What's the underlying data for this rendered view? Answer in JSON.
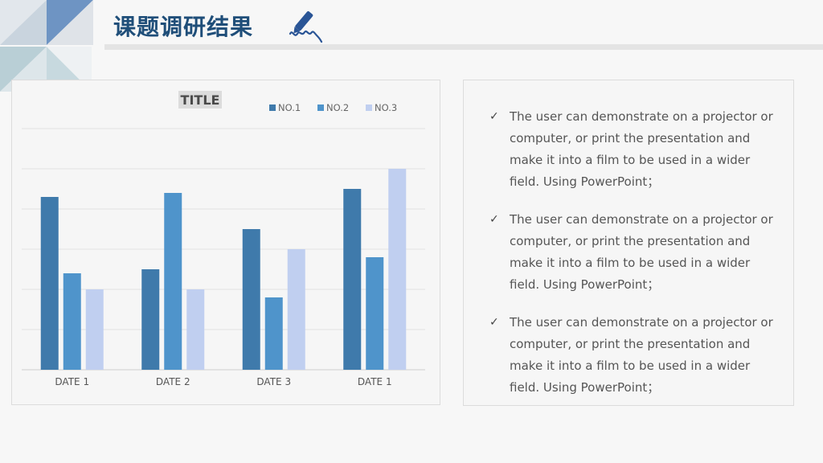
{
  "slide": {
    "heading": "课题调研结果",
    "colors": {
      "heading": "#1f4e79",
      "accent": "#2a5596"
    },
    "pen_icon": "pen-signature-icon"
  },
  "chart_data": {
    "type": "bar",
    "title": "TITLE",
    "categories": [
      "DATE 1",
      "DATE 2",
      "DATE 3",
      "DATE 1"
    ],
    "series": [
      {
        "name": "NO.1",
        "color": "#3f7aab",
        "values": [
          4.3,
          2.5,
          3.5,
          4.5
        ]
      },
      {
        "name": "NO.2",
        "color": "#4f94cb",
        "values": [
          2.4,
          4.4,
          1.8,
          2.8
        ]
      },
      {
        "name": "NO.3",
        "color": "#c0cff0",
        "values": [
          2.0,
          2.0,
          3.0,
          5.0
        ]
      }
    ],
    "ylim": [
      0,
      6
    ],
    "grid": true,
    "legend": "top-right"
  },
  "bullets": [
    "The user can demonstrate on a projector or computer, or print the presentation and make it into a film to be used in a wider field. Using PowerPoint；",
    "The user can demonstrate on a projector or computer, or print the presentation and make it into a film to be used in a wider field. Using PowerPoint；",
    "The user can demonstrate on a projector or computer, or print the presentation and make it into a film to be used in a wider field. Using PowerPoint；"
  ],
  "check_mark": "✓"
}
